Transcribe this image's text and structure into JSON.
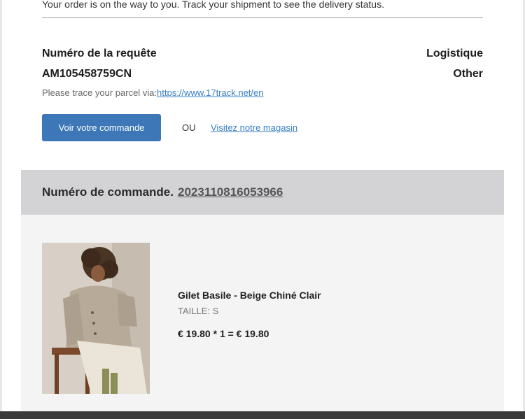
{
  "shipping": {
    "message": "Your order is on the way to you. Track your shipment to see the delivery status.",
    "request_label": "Numéro de la requête",
    "request_value": "AM105458759CN",
    "logistics_label": "Logistique",
    "logistics_value": "Other",
    "trace_prefix": "Please trace your parcel via:",
    "trace_link": "https://www.17track.net/en"
  },
  "actions": {
    "view_order_label": "Voir votre commande",
    "or_label": "OU",
    "visit_store_label": "Visitez notre magasin"
  },
  "order": {
    "label": "Numéro de commande.",
    "number": "2023110816053966"
  },
  "product": {
    "name": "Gilet Basile - Beige Chiné Clair",
    "size": "TAILLE: S",
    "price_line": "€ 19.80 * 1 = € 19.80"
  },
  "colors": {
    "button": "#3d77b7",
    "link": "#3a7fc4",
    "order_header_bg": "#d3d3d6",
    "order_body_bg": "#f4f4f4"
  }
}
